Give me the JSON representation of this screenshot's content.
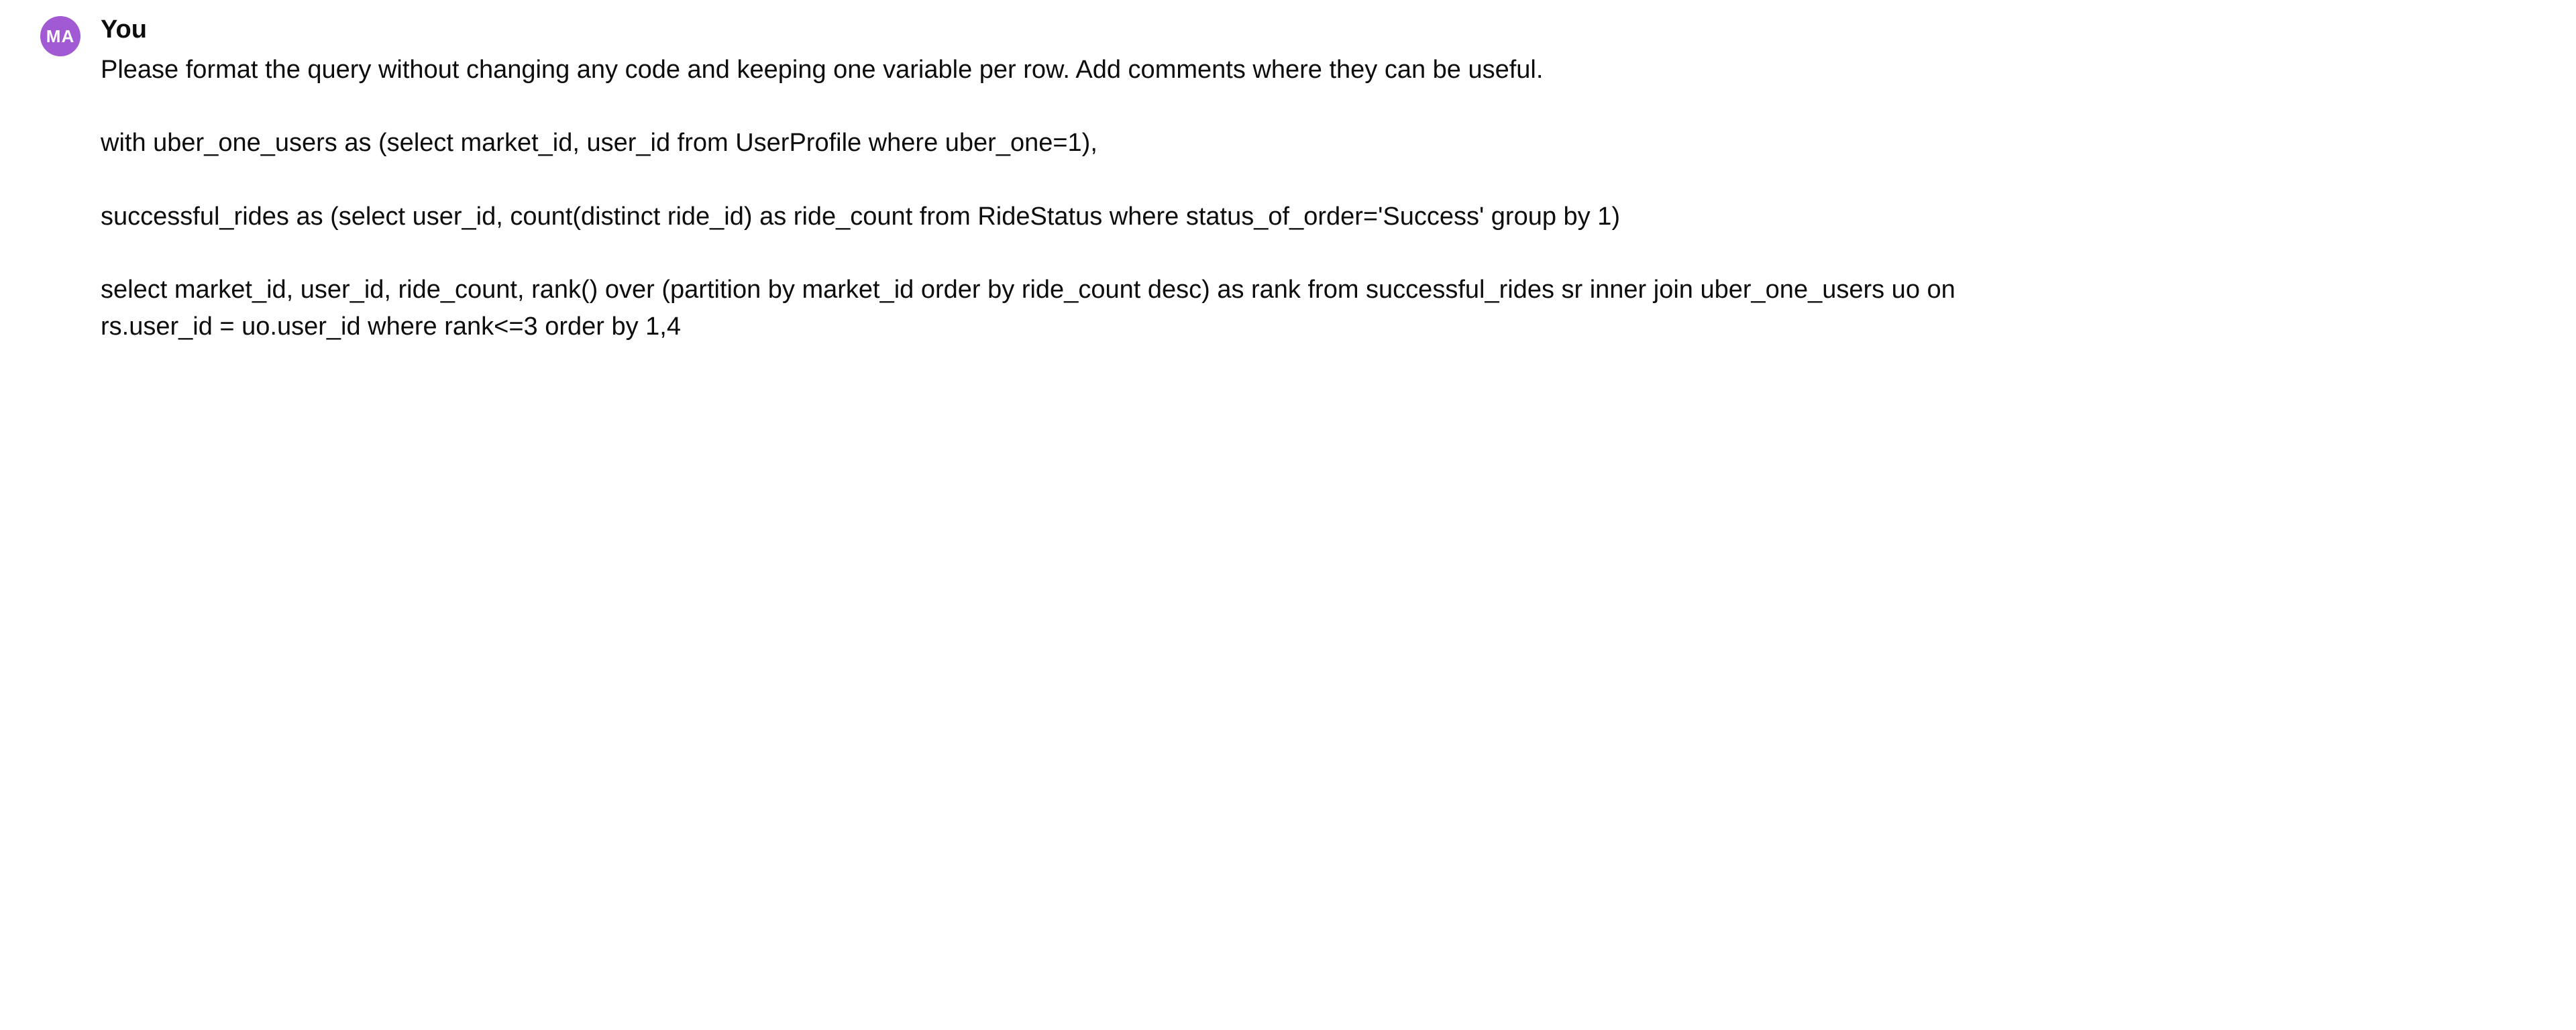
{
  "message": {
    "avatar_initials": "MA",
    "sender": "You",
    "paragraphs": [
      "Please format the query without changing any code and keeping one variable per row. Add comments where they can be useful.",
      "with uber_one_users as (select market_id, user_id from UserProfile where uber_one=1),",
      "successful_rides as (select user_id, count(distinct ride_id) as ride_count from RideStatus where status_of_order='Success' group by 1)",
      "select market_id, user_id, ride_count, rank() over (partition by market_id order by ride_count desc) as rank from successful_rides sr inner join uber_one_users uo on rs.user_id = uo.user_id where rank<=3 order by 1,4"
    ]
  }
}
